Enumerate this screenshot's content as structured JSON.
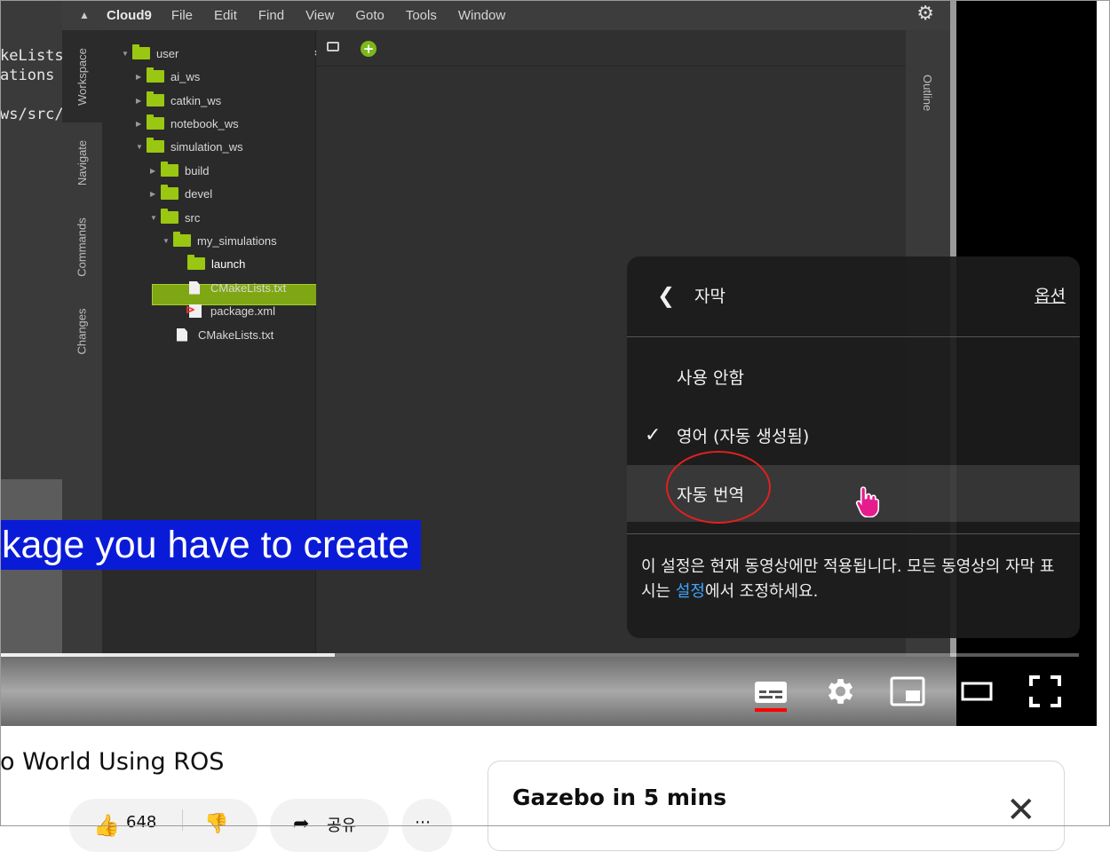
{
  "app": {
    "name": "Cloud9"
  },
  "menu": [
    "File",
    "Edit",
    "Find",
    "View",
    "Goto",
    "Tools",
    "Window"
  ],
  "terminal_lines": [
    "keLists",
    "ations",
    "",
    "ws/src/"
  ],
  "side_tabs": [
    "Workspace",
    "Navigate",
    "Commands",
    "Changes"
  ],
  "outline_tab": "Outline",
  "file_tree": [
    {
      "label": "user",
      "kind": "folder",
      "expanded": true,
      "depth": 0
    },
    {
      "label": "ai_ws",
      "kind": "folder",
      "expanded": false,
      "depth": 1
    },
    {
      "label": "catkin_ws",
      "kind": "folder",
      "expanded": false,
      "depth": 1
    },
    {
      "label": "notebook_ws",
      "kind": "folder",
      "expanded": false,
      "depth": 1
    },
    {
      "label": "simulation_ws",
      "kind": "folder",
      "expanded": true,
      "depth": 1
    },
    {
      "label": "build",
      "kind": "folder",
      "expanded": false,
      "depth": 2
    },
    {
      "label": "devel",
      "kind": "folder",
      "expanded": false,
      "depth": 2
    },
    {
      "label": "src",
      "kind": "folder",
      "expanded": true,
      "depth": 2
    },
    {
      "label": "my_simulations",
      "kind": "folder",
      "expanded": true,
      "depth": 3
    },
    {
      "label": "launch",
      "kind": "folder",
      "selected": true,
      "depth": 4
    },
    {
      "label": "CMakeLists.txt",
      "kind": "file",
      "depth": 4
    },
    {
      "label": "package.xml",
      "kind": "xml",
      "depth": 4
    },
    {
      "label": "CMakeLists.txt",
      "kind": "file",
      "depth": 3
    }
  ],
  "caption": "kage you have to create",
  "playback_progress": 0.31,
  "settings_panel": {
    "title": "자막",
    "options_link": "옵션",
    "items": [
      {
        "label": "사용 안함",
        "checked": false
      },
      {
        "label": "영어 (자동 생성됨)",
        "checked": true
      },
      {
        "label": "자동 번역",
        "checked": false,
        "hover": true
      }
    ],
    "note_part1": "이 설정은 현재 동영상에만 적용됩니다. 모든 동영상의 자막 표시는 ",
    "note_link": "설정",
    "note_part2": "에서 조정하세요."
  },
  "video_title": "o World Using ROS",
  "like_count": "648",
  "share_label": "공유",
  "card": {
    "title": "Gazebo in 5 mins"
  },
  "colors": {
    "accent_green": "#9ac712",
    "caption_bg": "#0a1bd8",
    "link": "#3ea6ff",
    "cc_underline": "#ff0000"
  }
}
